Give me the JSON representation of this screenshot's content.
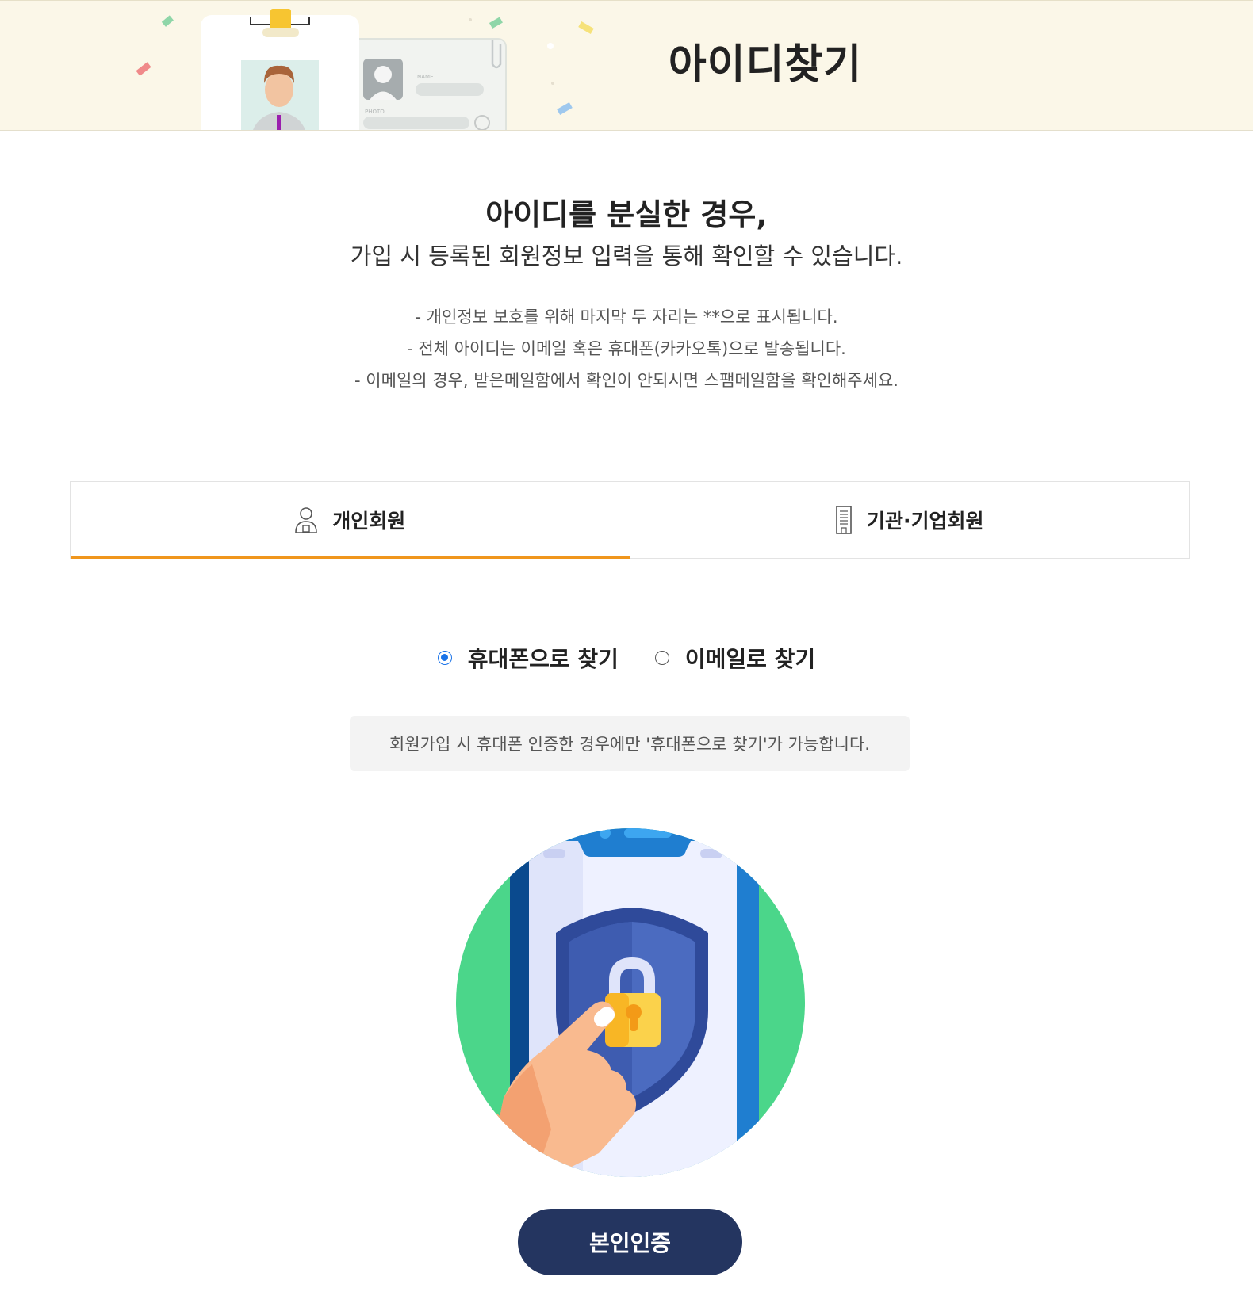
{
  "banner": {
    "title": "아이디찾기",
    "card_name_label": "NAME",
    "card_photo_label": "PHOTO"
  },
  "intro": {
    "headline": "아이디를 분실한 경우,",
    "subline": "가입 시 등록된 회원정보 입력을 통해 확인할 수 있습니다.",
    "notices": [
      "- 개인정보 보호를 위해 마지막 두 자리는 **으로 표시됩니다.",
      "- 전체 아이디는 이메일 혹은 휴대폰(카카오톡)으로 발송됩니다.",
      "- 이메일의 경우, 받은메일함에서 확인이 안되시면 스팸메일함을 확인해주세요."
    ]
  },
  "tabs": [
    {
      "label": "개인회원",
      "icon": "person-icon",
      "active": true
    },
    {
      "label": "기관·기업회원",
      "icon": "building-icon",
      "active": false
    }
  ],
  "methods": [
    {
      "label": "휴대폰으로 찾기",
      "checked": true
    },
    {
      "label": "이메일로 찾기",
      "checked": false
    }
  ],
  "info_box": {
    "text": "회원가입 시 휴대폰 인증한 경우에만 '휴대폰으로 찾기'가 가능합니다."
  },
  "verify_button": {
    "label": "본인인증"
  },
  "colors": {
    "banner_bg": "#fbf7e8",
    "tab_active_underline": "#f0961c",
    "radio_checked": "#1a73e8",
    "info_box_bg": "#f3f3f3",
    "button_bg": "#243560",
    "illustration_circle": "#4bd68a"
  }
}
